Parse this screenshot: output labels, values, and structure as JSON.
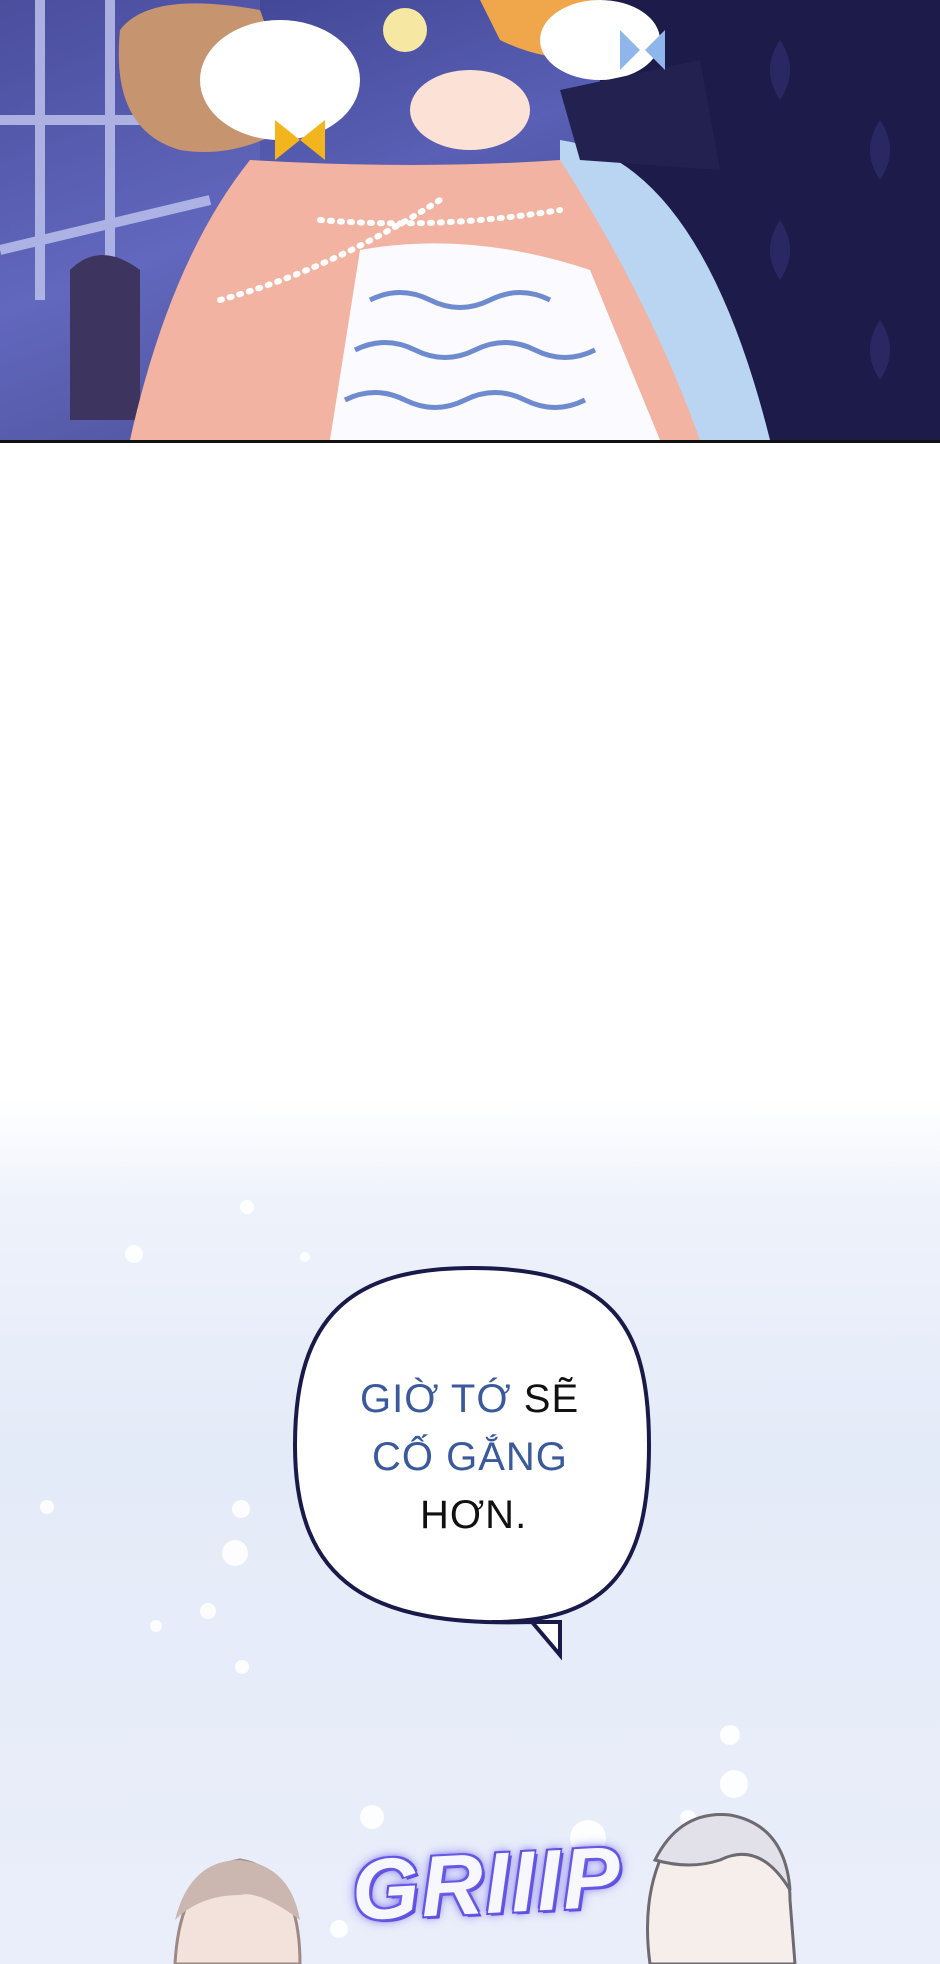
{
  "bubble": {
    "line1_a": "GIỜ TỚ",
    "line1_b": " SẼ",
    "line2_a": "CỐ GẮNG",
    "line3": "HƠN."
  },
  "sfx": {
    "text": "GRIIIP"
  },
  "colors": {
    "highlight_text": "#3a5a9c",
    "sfx_glow": "#6b5ce8",
    "panel_bg": "#e4ebf8"
  }
}
